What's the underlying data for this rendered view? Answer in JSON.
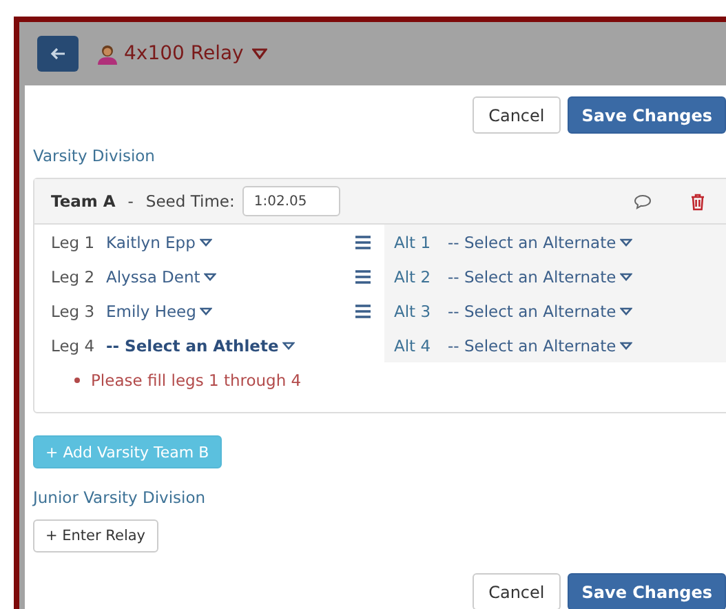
{
  "header": {
    "title": "4x100 Relay"
  },
  "top_buttons": {
    "cancel": "Cancel",
    "save": "Save Changes"
  },
  "divisions": [
    {
      "title": "Varsity Division",
      "teams": [
        {
          "name": "Team A",
          "separator": "-",
          "seed_label": "Seed Time:",
          "seed_time": "1:02.05",
          "legs": [
            {
              "label": "Leg 1",
              "athlete": "Kaitlyn Epp",
              "filled": true
            },
            {
              "label": "Leg 2",
              "athlete": "Alyssa Dent",
              "filled": true
            },
            {
              "label": "Leg 3",
              "athlete": "Emily Heeg",
              "filled": true
            },
            {
              "label": "Leg 4",
              "athlete": "-- Select an Athlete",
              "filled": false
            }
          ],
          "alternates": [
            {
              "label": "Alt 1",
              "athlete": "-- Select an Alternate"
            },
            {
              "label": "Alt 2",
              "athlete": "-- Select an Alternate"
            },
            {
              "label": "Alt 3",
              "athlete": "-- Select an Alternate"
            },
            {
              "label": "Alt 4",
              "athlete": "-- Select an Alternate"
            }
          ],
          "errors": [
            "Please fill legs 1 through 4"
          ]
        }
      ],
      "add_button": {
        "kind": "primary",
        "label": "+ Add Varsity Team B"
      }
    },
    {
      "title": "Junior Varsity Division",
      "add_button": {
        "kind": "plain",
        "label": "+ Enter Relay"
      }
    }
  ],
  "bottom_buttons": {
    "cancel": "Cancel",
    "save": "Save Changes"
  }
}
